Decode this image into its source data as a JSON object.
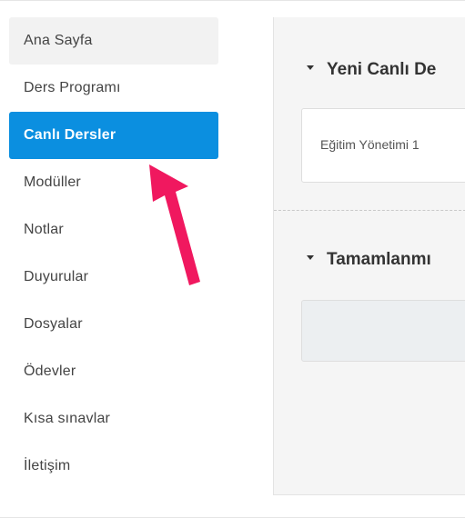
{
  "sidebar": {
    "items": [
      {
        "label": "Ana Sayfa"
      },
      {
        "label": "Ders Programı"
      },
      {
        "label": "Canlı Dersler"
      },
      {
        "label": "Modüller"
      },
      {
        "label": "Notlar"
      },
      {
        "label": "Duyurular"
      },
      {
        "label": "Dosyalar"
      },
      {
        "label": "Ödevler"
      },
      {
        "label": "Kısa sınavlar"
      },
      {
        "label": "İletişim"
      }
    ]
  },
  "main": {
    "upcoming_title": "Yeni Canlı De",
    "upcoming_item": "Eğitim Yönetimi 1",
    "completed_title": "Tamamlanmı"
  },
  "colors": {
    "accent": "#0b8fe0",
    "arrow": "#f0185f"
  }
}
